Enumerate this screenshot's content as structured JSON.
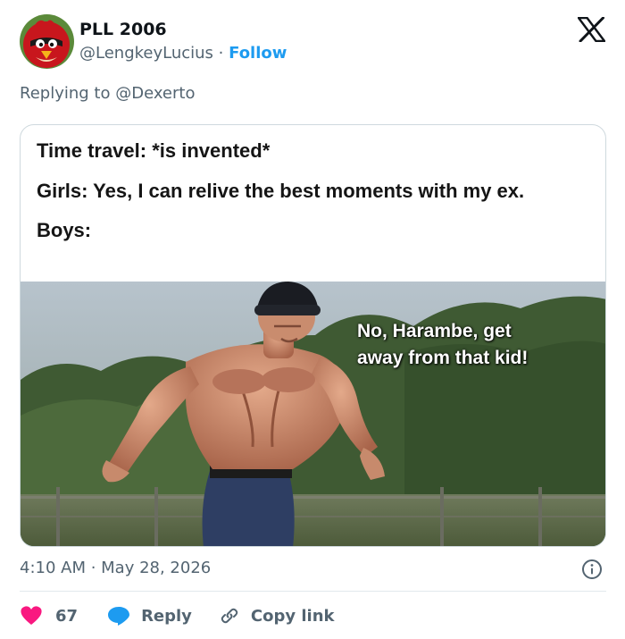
{
  "user": {
    "display_name": "PLL 2006",
    "handle": "@LengkeyLucius",
    "separator": "·",
    "follow_label": "Follow"
  },
  "reply_context": {
    "prefix": "Replying to ",
    "mention": "@Dexerto"
  },
  "meme": {
    "lines": [
      "Time travel: *is invented*",
      "Girls: Yes, I can relive the best moments with my ex.",
      "Boys:"
    ],
    "caption_lines": [
      "No, Harambe, get",
      "away from that kid!"
    ]
  },
  "meta": {
    "timestamp": "4:10 AM · May 28, 2026"
  },
  "actions": {
    "like_count": "67",
    "reply_label": "Reply",
    "copy_label": "Copy link"
  },
  "colors": {
    "like": "#f91880",
    "reply": "#1d9bf0",
    "link": "#1d9bf0",
    "muted": "#536471",
    "border": "#cfd9de"
  },
  "icons": {
    "brand": "x-logo-icon",
    "info": "info-icon",
    "like": "heart-icon",
    "reply": "speech-bubble-icon",
    "copy": "link-icon"
  }
}
